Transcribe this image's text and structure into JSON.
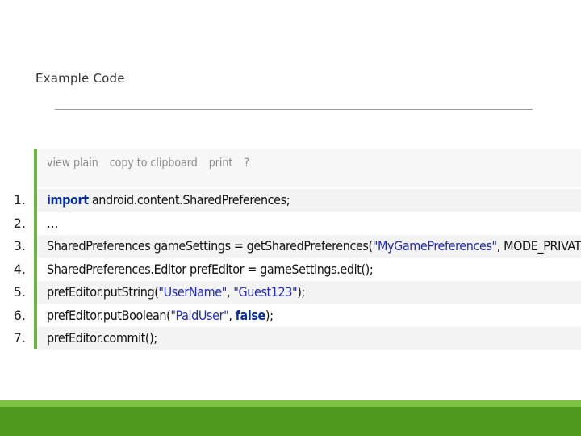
{
  "slide": {
    "title": "Example Code"
  },
  "toolbar": {
    "links": [
      "view plain",
      "copy to clipboard",
      "print",
      "?"
    ]
  },
  "code": {
    "lines": [
      {
        "num": "1.",
        "tokens": [
          {
            "t": "import",
            "c": "kw"
          },
          {
            "t": " android.content.SharedPreferences;",
            "c": ""
          }
        ]
      },
      {
        "num": "2.",
        "tokens": [
          {
            "t": "…",
            "c": ""
          }
        ]
      },
      {
        "num": "3.",
        "tokens": [
          {
            "t": "SharedPreferences gameSettings = getSharedPreferences(",
            "c": ""
          },
          {
            "t": "\"MyGamePreferences\"",
            "c": "str"
          },
          {
            "t": ", MODE_PRIVATE);",
            "c": ""
          }
        ]
      },
      {
        "num": "4.",
        "tokens": [
          {
            "t": "SharedPreferences.Editor prefEditor = gameSettings.edit();",
            "c": ""
          }
        ]
      },
      {
        "num": "5.",
        "tokens": [
          {
            "t": "prefEditor.putString(",
            "c": ""
          },
          {
            "t": "\"UserName\"",
            "c": "str"
          },
          {
            "t": ", ",
            "c": ""
          },
          {
            "t": "\"Guest123\"",
            "c": "str"
          },
          {
            "t": ");",
            "c": ""
          }
        ]
      },
      {
        "num": "6.",
        "tokens": [
          {
            "t": "prefEditor.putBoolean(",
            "c": ""
          },
          {
            "t": "\"PaidUser\"",
            "c": "str"
          },
          {
            "t": ", ",
            "c": ""
          },
          {
            "t": "false",
            "c": "kw"
          },
          {
            "t": ");",
            "c": ""
          }
        ]
      },
      {
        "num": "7.",
        "tokens": [
          {
            "t": "prefEditor.commit();",
            "c": ""
          }
        ]
      }
    ]
  },
  "colors": {
    "accent_green": "#6cb33f",
    "footer_green": "#4f9a1e",
    "keyword": "#0b2f99",
    "string": "#1f2bb8"
  }
}
